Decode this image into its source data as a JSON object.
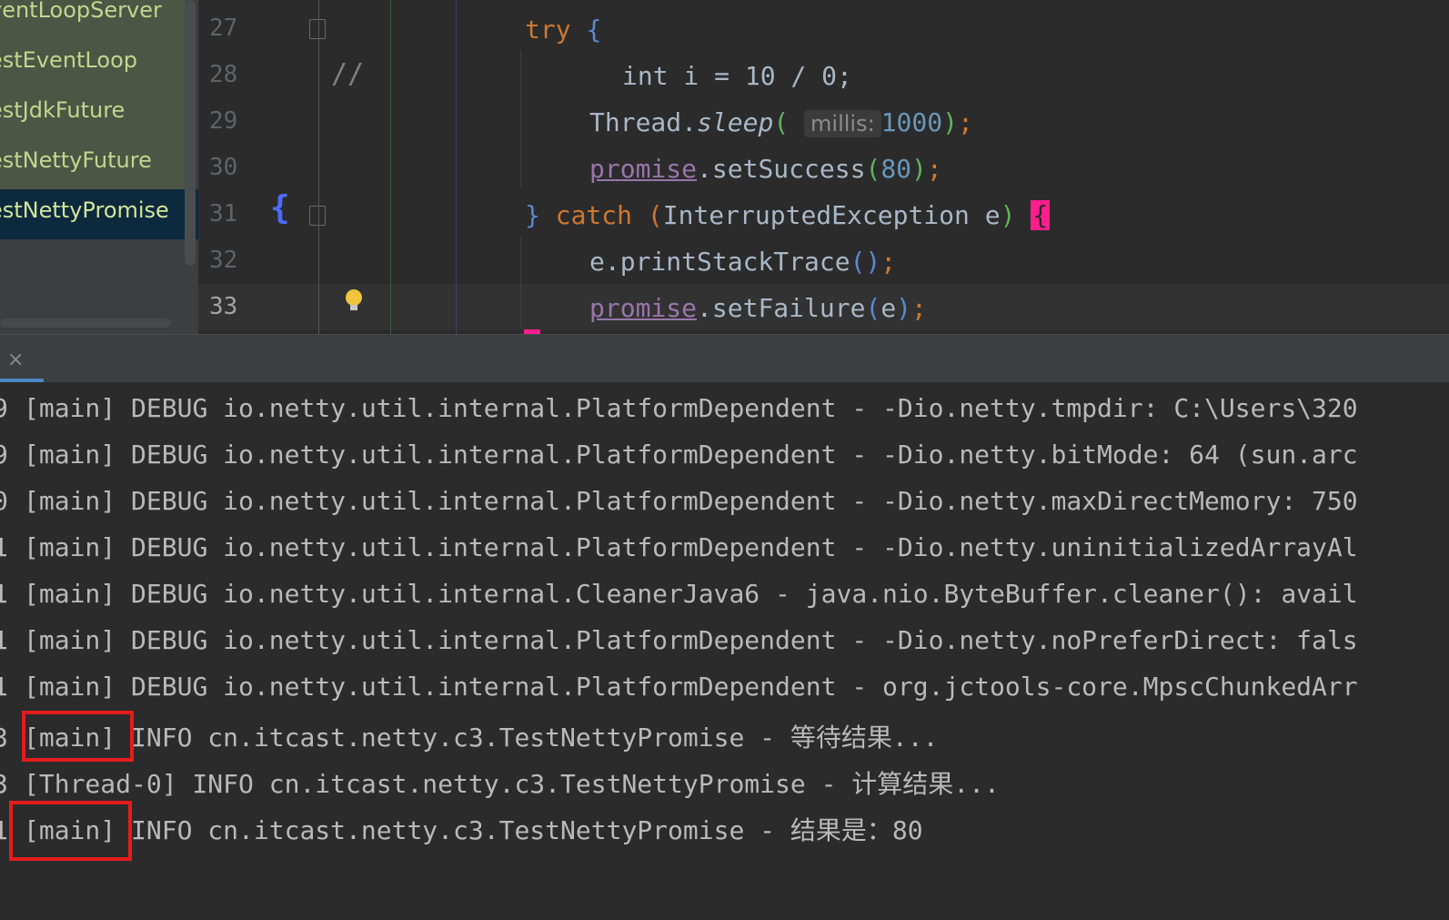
{
  "project_tree": {
    "items": [
      {
        "label": "ventLoopServer",
        "selected": false
      },
      {
        "label": "estEventLoop",
        "selected": false
      },
      {
        "label": "estJdkFuture",
        "selected": false
      },
      {
        "label": "estNettyFuture",
        "selected": false
      },
      {
        "label": "estNettyPromise",
        "selected": true
      }
    ]
  },
  "editor": {
    "gutter": [
      "27",
      "28",
      "29",
      "30",
      "31",
      "32",
      "33"
    ],
    "current_line": "33",
    "comment_marker": "//",
    "brace_marker": "{",
    "lines": {
      "l27": {
        "kw": "try",
        "brace": "{"
      },
      "l28": {
        "code": "int i = 10 / 0;"
      },
      "l29": {
        "obj": "Thread.",
        "method": "sleep",
        "open": "(",
        "hint": "millis:",
        "num": "1000",
        "close": ")",
        "end": ";"
      },
      "l30": {
        "field": "promise",
        "call": ".setSuccess",
        "open": "(",
        "num": "80",
        "close": ")",
        "end": ";"
      },
      "l31": {
        "close_brace": "}",
        "kw": "catch",
        "open": "(",
        "args": "InterruptedException e",
        "close": ")",
        "brace": "{"
      },
      "l32": {
        "call": "e.printStackTrace",
        "parens": "()",
        "end": ";"
      },
      "l33": {
        "field": "promise",
        "call": ".setFailure",
        "open": "(",
        "arg": "e",
        "close": ")",
        "end": ";"
      }
    }
  },
  "console": {
    "close_label": "×",
    "lines": [
      {
        "prefix": "9",
        "thread": "[main]",
        "text": " DEBUG io.netty.util.internal.PlatformDependent - -Dio.netty.tmpdir: C:\\Users\\320"
      },
      {
        "prefix": "9",
        "thread": "[main]",
        "text": " DEBUG io.netty.util.internal.PlatformDependent - -Dio.netty.bitMode: 64 (sun.arc"
      },
      {
        "prefix": "0",
        "thread": "[main]",
        "text": " DEBUG io.netty.util.internal.PlatformDependent - -Dio.netty.maxDirectMemory: 750"
      },
      {
        "prefix": "1",
        "thread": "[main]",
        "text": " DEBUG io.netty.util.internal.PlatformDependent - -Dio.netty.uninitializedArrayAl"
      },
      {
        "prefix": "1",
        "thread": "[main]",
        "text": " DEBUG io.netty.util.internal.CleanerJava6 - java.nio.ByteBuffer.cleaner(): avail"
      },
      {
        "prefix": "1",
        "thread": "[main]",
        "text": " DEBUG io.netty.util.internal.PlatformDependent - -Dio.netty.noPreferDirect: fals"
      },
      {
        "prefix": "1",
        "thread": "[main]",
        "text": " DEBUG io.netty.util.internal.PlatformDependent - org.jctools-core.MpscChunkedArr"
      },
      {
        "prefix": "3",
        "thread": "[main]",
        "text": " INFO cn.itcast.netty.c3.TestNettyPromise - 等待结果..."
      },
      {
        "prefix": "3",
        "thread": "[Thread-0]",
        "text": " INFO cn.itcast.netty.c3.TestNettyPromise - 计算结果..."
      },
      {
        "prefix": "1",
        "thread": "[main]",
        "text": " INFO cn.itcast.netty.c3.TestNettyPromise - 结果是：80"
      }
    ]
  },
  "colors": {
    "highlight_box": "#e51c1c",
    "keyword": "#cc7832",
    "tree_text": "#c3d68f"
  }
}
